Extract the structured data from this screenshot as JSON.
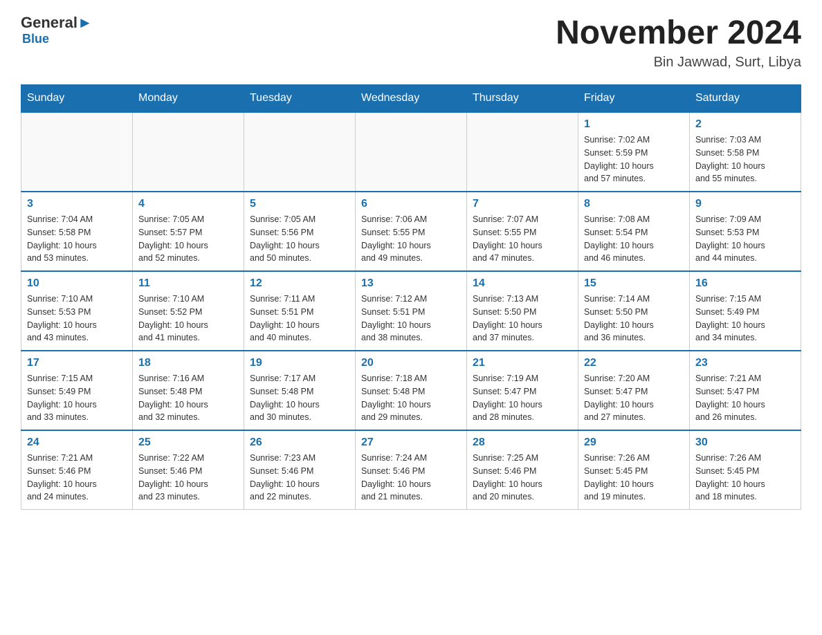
{
  "header": {
    "logo_general": "General",
    "logo_blue": "Blue",
    "month_title": "November 2024",
    "location": "Bin Jawwad, Surt, Libya"
  },
  "days_of_week": [
    "Sunday",
    "Monday",
    "Tuesday",
    "Wednesday",
    "Thursday",
    "Friday",
    "Saturday"
  ],
  "weeks": [
    [
      {
        "day": "",
        "info": ""
      },
      {
        "day": "",
        "info": ""
      },
      {
        "day": "",
        "info": ""
      },
      {
        "day": "",
        "info": ""
      },
      {
        "day": "",
        "info": ""
      },
      {
        "day": "1",
        "info": "Sunrise: 7:02 AM\nSunset: 5:59 PM\nDaylight: 10 hours\nand 57 minutes."
      },
      {
        "day": "2",
        "info": "Sunrise: 7:03 AM\nSunset: 5:58 PM\nDaylight: 10 hours\nand 55 minutes."
      }
    ],
    [
      {
        "day": "3",
        "info": "Sunrise: 7:04 AM\nSunset: 5:58 PM\nDaylight: 10 hours\nand 53 minutes."
      },
      {
        "day": "4",
        "info": "Sunrise: 7:05 AM\nSunset: 5:57 PM\nDaylight: 10 hours\nand 52 minutes."
      },
      {
        "day": "5",
        "info": "Sunrise: 7:05 AM\nSunset: 5:56 PM\nDaylight: 10 hours\nand 50 minutes."
      },
      {
        "day": "6",
        "info": "Sunrise: 7:06 AM\nSunset: 5:55 PM\nDaylight: 10 hours\nand 49 minutes."
      },
      {
        "day": "7",
        "info": "Sunrise: 7:07 AM\nSunset: 5:55 PM\nDaylight: 10 hours\nand 47 minutes."
      },
      {
        "day": "8",
        "info": "Sunrise: 7:08 AM\nSunset: 5:54 PM\nDaylight: 10 hours\nand 46 minutes."
      },
      {
        "day": "9",
        "info": "Sunrise: 7:09 AM\nSunset: 5:53 PM\nDaylight: 10 hours\nand 44 minutes."
      }
    ],
    [
      {
        "day": "10",
        "info": "Sunrise: 7:10 AM\nSunset: 5:53 PM\nDaylight: 10 hours\nand 43 minutes."
      },
      {
        "day": "11",
        "info": "Sunrise: 7:10 AM\nSunset: 5:52 PM\nDaylight: 10 hours\nand 41 minutes."
      },
      {
        "day": "12",
        "info": "Sunrise: 7:11 AM\nSunset: 5:51 PM\nDaylight: 10 hours\nand 40 minutes."
      },
      {
        "day": "13",
        "info": "Sunrise: 7:12 AM\nSunset: 5:51 PM\nDaylight: 10 hours\nand 38 minutes."
      },
      {
        "day": "14",
        "info": "Sunrise: 7:13 AM\nSunset: 5:50 PM\nDaylight: 10 hours\nand 37 minutes."
      },
      {
        "day": "15",
        "info": "Sunrise: 7:14 AM\nSunset: 5:50 PM\nDaylight: 10 hours\nand 36 minutes."
      },
      {
        "day": "16",
        "info": "Sunrise: 7:15 AM\nSunset: 5:49 PM\nDaylight: 10 hours\nand 34 minutes."
      }
    ],
    [
      {
        "day": "17",
        "info": "Sunrise: 7:15 AM\nSunset: 5:49 PM\nDaylight: 10 hours\nand 33 minutes."
      },
      {
        "day": "18",
        "info": "Sunrise: 7:16 AM\nSunset: 5:48 PM\nDaylight: 10 hours\nand 32 minutes."
      },
      {
        "day": "19",
        "info": "Sunrise: 7:17 AM\nSunset: 5:48 PM\nDaylight: 10 hours\nand 30 minutes."
      },
      {
        "day": "20",
        "info": "Sunrise: 7:18 AM\nSunset: 5:48 PM\nDaylight: 10 hours\nand 29 minutes."
      },
      {
        "day": "21",
        "info": "Sunrise: 7:19 AM\nSunset: 5:47 PM\nDaylight: 10 hours\nand 28 minutes."
      },
      {
        "day": "22",
        "info": "Sunrise: 7:20 AM\nSunset: 5:47 PM\nDaylight: 10 hours\nand 27 minutes."
      },
      {
        "day": "23",
        "info": "Sunrise: 7:21 AM\nSunset: 5:47 PM\nDaylight: 10 hours\nand 26 minutes."
      }
    ],
    [
      {
        "day": "24",
        "info": "Sunrise: 7:21 AM\nSunset: 5:46 PM\nDaylight: 10 hours\nand 24 minutes."
      },
      {
        "day": "25",
        "info": "Sunrise: 7:22 AM\nSunset: 5:46 PM\nDaylight: 10 hours\nand 23 minutes."
      },
      {
        "day": "26",
        "info": "Sunrise: 7:23 AM\nSunset: 5:46 PM\nDaylight: 10 hours\nand 22 minutes."
      },
      {
        "day": "27",
        "info": "Sunrise: 7:24 AM\nSunset: 5:46 PM\nDaylight: 10 hours\nand 21 minutes."
      },
      {
        "day": "28",
        "info": "Sunrise: 7:25 AM\nSunset: 5:46 PM\nDaylight: 10 hours\nand 20 minutes."
      },
      {
        "day": "29",
        "info": "Sunrise: 7:26 AM\nSunset: 5:45 PM\nDaylight: 10 hours\nand 19 minutes."
      },
      {
        "day": "30",
        "info": "Sunrise: 7:26 AM\nSunset: 5:45 PM\nDaylight: 10 hours\nand 18 minutes."
      }
    ]
  ]
}
